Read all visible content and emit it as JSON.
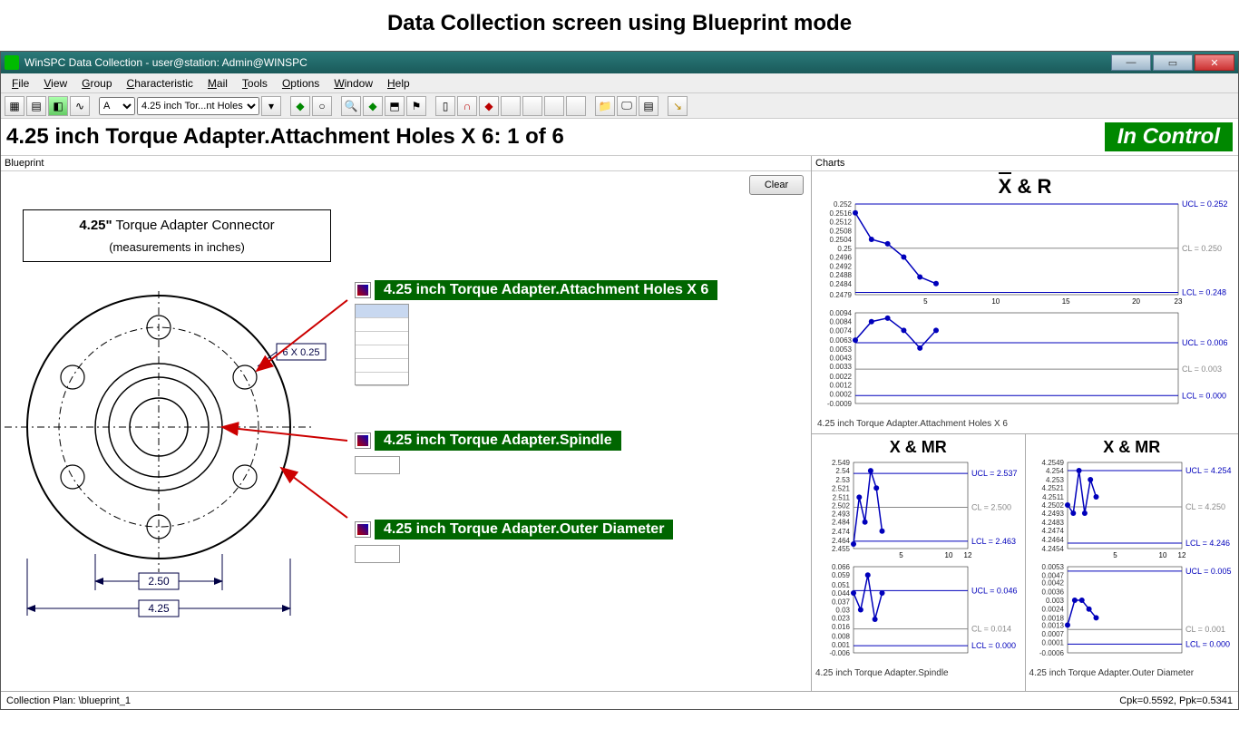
{
  "page_heading": "Data Collection screen using Blueprint mode",
  "window_title": "WinSPC Data Collection - user@station: Admin@WINSPC",
  "menus": [
    "File",
    "View",
    "Group",
    "Characteristic",
    "Mail",
    "Tools",
    "Options",
    "Window",
    "Help"
  ],
  "toolbar": {
    "sel_a": "A",
    "sel_char": "4.25 inch Tor...nt Holes X"
  },
  "info": {
    "line": "4.25 inch Torque Adapter.Attachment Holes X 6:  1 of 6",
    "status": "In Control"
  },
  "panels": {
    "blueprint": "Blueprint",
    "charts": "Charts"
  },
  "clear_btn": "Clear",
  "bp_title": {
    "l1a": "4.25\"",
    "l1b": "  Torque Adapter Connector",
    "l2": "(measurements in inches)"
  },
  "bp_note_6x": "6 X 0.25",
  "bp_dim_250": "2.50",
  "bp_dim_425": "4.25",
  "labels": {
    "att": "4.25 inch Torque Adapter.Attachment Holes X 6",
    "spindle": "4.25 inch Torque Adapter.Spindle",
    "od": "4.25 inch Torque Adapter.Outer Diameter"
  },
  "statusbar": {
    "plan": "Collection Plan: \\blueprint_1",
    "cpk": "Cpk=0.5592, Ppk=0.5341"
  },
  "chart_data": [
    {
      "type": "line",
      "title": "X̄ & R",
      "subtitle": "4.25 inch Torque Adapter.Attachment Holes X 6",
      "panels": [
        {
          "series": [
            {
              "name": "X̄",
              "values": [
                0.2516,
                0.2504,
                0.2502,
                0.2496,
                0.2487,
                0.2484
              ]
            }
          ],
          "ucl": 0.252,
          "cl": 0.25,
          "lcl": 0.248,
          "y_ticks": [
            0.2479,
            0.2484,
            0.2488,
            0.2492,
            0.2496,
            0.25,
            0.2504,
            0.2508,
            0.2512,
            0.2516,
            0.252
          ],
          "x_ticks": [
            5,
            10,
            15,
            20,
            23
          ]
        },
        {
          "series": [
            {
              "name": "R",
              "values": [
                0.0063,
                0.0084,
                0.0088,
                0.0074,
                0.0054,
                0.0074
              ]
            }
          ],
          "ucl": 0.006,
          "cl": 0.003,
          "lcl": 0.0,
          "y_ticks": [
            -0.0009,
            0.0002,
            0.0012,
            0.0022,
            0.0033,
            0.0043,
            0.0053,
            0.0063,
            0.0074,
            0.0084,
            0.0094
          ]
        }
      ]
    },
    {
      "type": "line",
      "title": "X & MR",
      "subtitle": "4.25 inch Torque Adapter.Spindle",
      "panels": [
        {
          "series": [
            {
              "name": "X",
              "values": [
                2.46,
                2.511,
                2.484,
                2.54,
                2.521,
                2.474
              ]
            }
          ],
          "ucl": 2.537,
          "cl": 2.5,
          "lcl": 2.463,
          "y_ticks": [
            2.455,
            2.464,
            2.474,
            2.484,
            2.493,
            2.502,
            2.511,
            2.521,
            2.53,
            2.54,
            2.549
          ],
          "x_ticks": [
            5,
            10,
            12
          ]
        },
        {
          "series": [
            {
              "name": "MR",
              "values": [
                0.044,
                0.03,
                0.059,
                0.022,
                0.044
              ]
            }
          ],
          "ucl": 0.046,
          "cl": 0.014,
          "lcl": 0.0,
          "y_ticks": [
            -0.006,
            0.001,
            0.008,
            0.016,
            0.023,
            0.03,
            0.037,
            0.044,
            0.051,
            0.059,
            0.066
          ]
        }
      ]
    },
    {
      "type": "line",
      "title": "X & MR",
      "subtitle": "4.25 inch Torque Adapter.Outer Diameter",
      "panels": [
        {
          "series": [
            {
              "name": "X",
              "values": [
                4.2502,
                4.2493,
                4.254,
                4.2493,
                4.253,
                4.2511
              ]
            }
          ],
          "ucl": 4.254,
          "cl": 4.25,
          "lcl": 4.246,
          "y_ticks": [
            4.2454,
            4.2464,
            4.2474,
            4.2483,
            4.2493,
            4.2502,
            4.2511,
            4.2521,
            4.253,
            4.254,
            4.2549
          ],
          "x_ticks": [
            5,
            10,
            12
          ]
        },
        {
          "series": [
            {
              "name": "MR",
              "values": [
                0.0013,
                0.003,
                0.003,
                0.0024,
                0.0018
              ]
            }
          ],
          "ucl": 0.005,
          "cl": 0.001,
          "lcl": 0.0,
          "y_ticks": [
            -0.0006,
            0.0001,
            0.0007,
            0.0013,
            0.0018,
            0.0024,
            0.003,
            0.0036,
            0.0042,
            0.0047,
            0.0053
          ]
        }
      ]
    }
  ]
}
